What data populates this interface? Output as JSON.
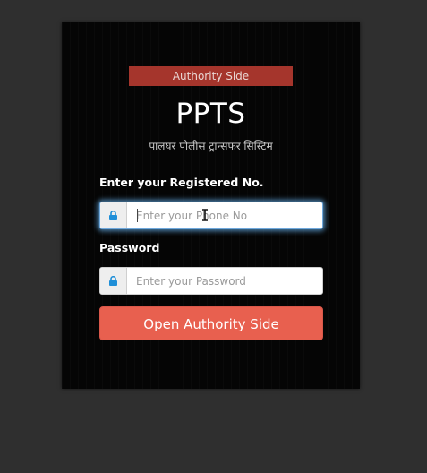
{
  "badge": "Authority Side",
  "app_title": "PPTS",
  "subtitle": "पालघर पोलीस ट्रान्सफर सिस्टिम",
  "form": {
    "registered_label": "Enter your Registered No.",
    "phone_placeholder": "Enter your Phone No",
    "phone_value": "",
    "password_label": "Password",
    "password_placeholder": "Enter your Password",
    "password_value": "",
    "submit_label": "Open Authority Side"
  },
  "icons": {
    "phone_field_icon": "lock-icon",
    "password_field_icon": "lock-icon",
    "pointer": "text-cursor-icon"
  },
  "colors": {
    "background": "#2f2f2f",
    "card": "#050505",
    "badge": "#a5352c",
    "button": "#e8604f",
    "lock_icon": "#1f8fd8",
    "focus_glow": "#66afe9"
  }
}
